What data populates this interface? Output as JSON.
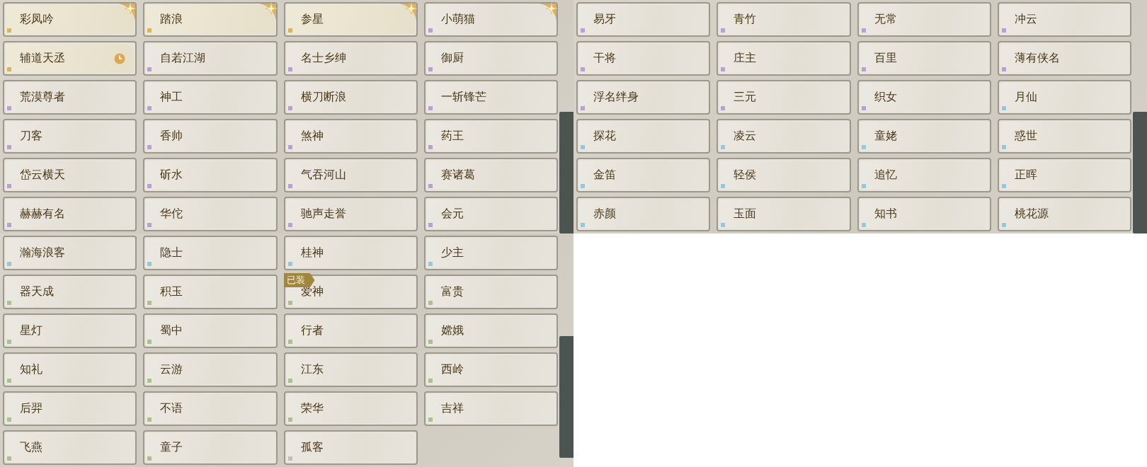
{
  "panels": [
    {
      "cards": [
        {
          "name": "彩凤吟",
          "color": "#d9b262",
          "starred": true,
          "timed": false
        },
        {
          "name": "踏浪",
          "color": "#d9b262",
          "starred": true,
          "timed": false
        },
        {
          "name": "参星",
          "color": "#d9b262",
          "starred": true,
          "timed": false
        },
        {
          "name": "小萌猫",
          "color": "#b9a0d4",
          "starred": true,
          "timed": false
        },
        {
          "name": "辅道天丞",
          "color": "#d9b262",
          "starred": false,
          "timed": true
        },
        {
          "name": "自若江湖",
          "color": "#b9a0d4",
          "starred": false,
          "timed": false
        },
        {
          "name": "名士乡绅",
          "color": "#b9a0d4",
          "starred": false,
          "timed": false
        },
        {
          "name": "御厨",
          "color": "#b9a0d4",
          "starred": false,
          "timed": false
        },
        {
          "name": "荒漠尊者",
          "color": "#b9a0d4",
          "starred": false,
          "timed": false
        },
        {
          "name": "神工",
          "color": "#b9a0d4",
          "starred": false,
          "timed": false
        },
        {
          "name": "横刀断浪",
          "color": "#b9a0d4",
          "starred": false,
          "timed": false
        },
        {
          "name": "一斩锋芒",
          "color": "#b9a0d4",
          "starred": false,
          "timed": false
        },
        {
          "name": "刀客",
          "color": "#b9a0d4",
          "starred": false,
          "timed": false
        },
        {
          "name": "香帅",
          "color": "#b9a0d4",
          "starred": false,
          "timed": false
        },
        {
          "name": "煞神",
          "color": "#b9a0d4",
          "starred": false,
          "timed": false
        },
        {
          "name": "药王",
          "color": "#b9a0d4",
          "starred": false,
          "timed": false
        },
        {
          "name": "岱云横天",
          "color": "#b9a0d4",
          "starred": false,
          "timed": false
        },
        {
          "name": "斫水",
          "color": "#b9a0d4",
          "starred": false,
          "timed": false
        },
        {
          "name": "气吞河山",
          "color": "#b9a0d4",
          "starred": false,
          "timed": false
        },
        {
          "name": "赛诸葛",
          "color": "#b9a0d4",
          "starred": false,
          "timed": false
        },
        {
          "name": "赫赫有名",
          "color": "#b9a0d4",
          "starred": false,
          "timed": false
        },
        {
          "name": "华佗",
          "color": "#b9a0d4",
          "starred": false,
          "timed": false
        },
        {
          "name": "驰声走誉",
          "color": "#b9a0d4",
          "starred": false,
          "timed": false
        },
        {
          "name": "会元",
          "color": "#b9a0d4",
          "starred": false,
          "timed": false
        }
      ]
    },
    {
      "cards": [
        {
          "name": "易牙",
          "color": "#b9a0d4",
          "starred": false,
          "timed": false
        },
        {
          "name": "青竹",
          "color": "#b9a0d4",
          "starred": false,
          "timed": false
        },
        {
          "name": "无常",
          "color": "#b9a0d4",
          "starred": false,
          "timed": false
        },
        {
          "name": "冲云",
          "color": "#b9a0d4",
          "starred": false,
          "timed": false
        },
        {
          "name": "干将",
          "color": "#b9a0d4",
          "starred": false,
          "timed": false
        },
        {
          "name": "庄主",
          "color": "#b9a0d4",
          "starred": false,
          "timed": false
        },
        {
          "name": "百里",
          "color": "#b9a0d4",
          "starred": false,
          "timed": false
        },
        {
          "name": "薄有侠名",
          "color": "#b9a0d4",
          "starred": false,
          "timed": false
        },
        {
          "name": "浮名绊身",
          "color": "#b9a0d4",
          "starred": false,
          "timed": false
        },
        {
          "name": "三元",
          "color": "#b9a0d4",
          "starred": false,
          "timed": false
        },
        {
          "name": "织女",
          "color": "#b9a0d4",
          "starred": false,
          "timed": false
        },
        {
          "name": "月仙",
          "color": "#98c6dc",
          "starred": false,
          "timed": false
        },
        {
          "name": "探花",
          "color": "#98c6dc",
          "starred": false,
          "timed": false
        },
        {
          "name": "凌云",
          "color": "#98c6dc",
          "starred": false,
          "timed": false
        },
        {
          "name": "童姥",
          "color": "#98c6dc",
          "starred": false,
          "timed": false
        },
        {
          "name": "惑世",
          "color": "#98c6dc",
          "starred": false,
          "timed": false
        },
        {
          "name": "金笛",
          "color": "#98c6dc",
          "starred": false,
          "timed": false
        },
        {
          "name": "轻侯",
          "color": "#98c6dc",
          "starred": false,
          "timed": false
        },
        {
          "name": "追忆",
          "color": "#98c6dc",
          "starred": false,
          "timed": false
        },
        {
          "name": "正晖",
          "color": "#98c6dc",
          "starred": false,
          "timed": false
        },
        {
          "name": "赤颜",
          "color": "#98c6dc",
          "starred": false,
          "timed": false
        },
        {
          "name": "玉面",
          "color": "#98c6dc",
          "starred": false,
          "timed": false
        },
        {
          "name": "知书",
          "color": "#98c6dc",
          "starred": false,
          "timed": false
        },
        {
          "name": "桃花源",
          "color": "#98c6dc",
          "starred": false,
          "timed": false
        }
      ]
    },
    {
      "cards": [
        {
          "name": "瀚海浪客",
          "color": "#98c6dc",
          "starred": false,
          "timed": false
        },
        {
          "name": "隐士",
          "color": "#98c6dc",
          "starred": false,
          "timed": false
        },
        {
          "name": "桂神",
          "color": "#98c6dc",
          "starred": false,
          "timed": false
        },
        {
          "name": "少主",
          "color": "#98c6dc",
          "starred": false,
          "timed": false
        },
        {
          "name": "器天成",
          "color": "#a9c28f",
          "starred": false,
          "timed": false
        },
        {
          "name": "积玉",
          "color": "#a9c28f",
          "starred": false,
          "timed": false
        },
        {
          "name": "爱神",
          "color": "#a9c28f",
          "starred": false,
          "timed": false,
          "badge": "已装"
        },
        {
          "name": "富贵",
          "color": "#a9c28f",
          "starred": false,
          "timed": false
        },
        {
          "name": "星灯",
          "color": "#a9c28f",
          "starred": false,
          "timed": false
        },
        {
          "name": "蜀中",
          "color": "#a9c28f",
          "starred": false,
          "timed": false
        },
        {
          "name": "行者",
          "color": "#a9c28f",
          "starred": false,
          "timed": false
        },
        {
          "name": "嫦娥",
          "color": "#a9c28f",
          "starred": false,
          "timed": false
        },
        {
          "name": "知礼",
          "color": "#a9c28f",
          "starred": false,
          "timed": false
        },
        {
          "name": "云游",
          "color": "#a9c28f",
          "starred": false,
          "timed": false
        },
        {
          "name": "江东",
          "color": "#a9c28f",
          "starred": false,
          "timed": false
        },
        {
          "name": "西岭",
          "color": "#a9c28f",
          "starred": false,
          "timed": false
        },
        {
          "name": "后羿",
          "color": "#a9c28f",
          "starred": false,
          "timed": false
        },
        {
          "name": "不语",
          "color": "#a9c28f",
          "starred": false,
          "timed": false
        },
        {
          "name": "荣华",
          "color": "#a9c28f",
          "starred": false,
          "timed": false
        },
        {
          "name": "吉祥",
          "color": "#a9c28f",
          "starred": false,
          "timed": false
        },
        {
          "name": "飞燕",
          "color": "#a9c28f",
          "starred": false,
          "timed": false
        },
        {
          "name": "童子",
          "color": "#a9c28f",
          "starred": false,
          "timed": false
        },
        {
          "name": "孤客",
          "color": "#c4bfb6",
          "starred": false,
          "timed": false
        }
      ]
    }
  ]
}
